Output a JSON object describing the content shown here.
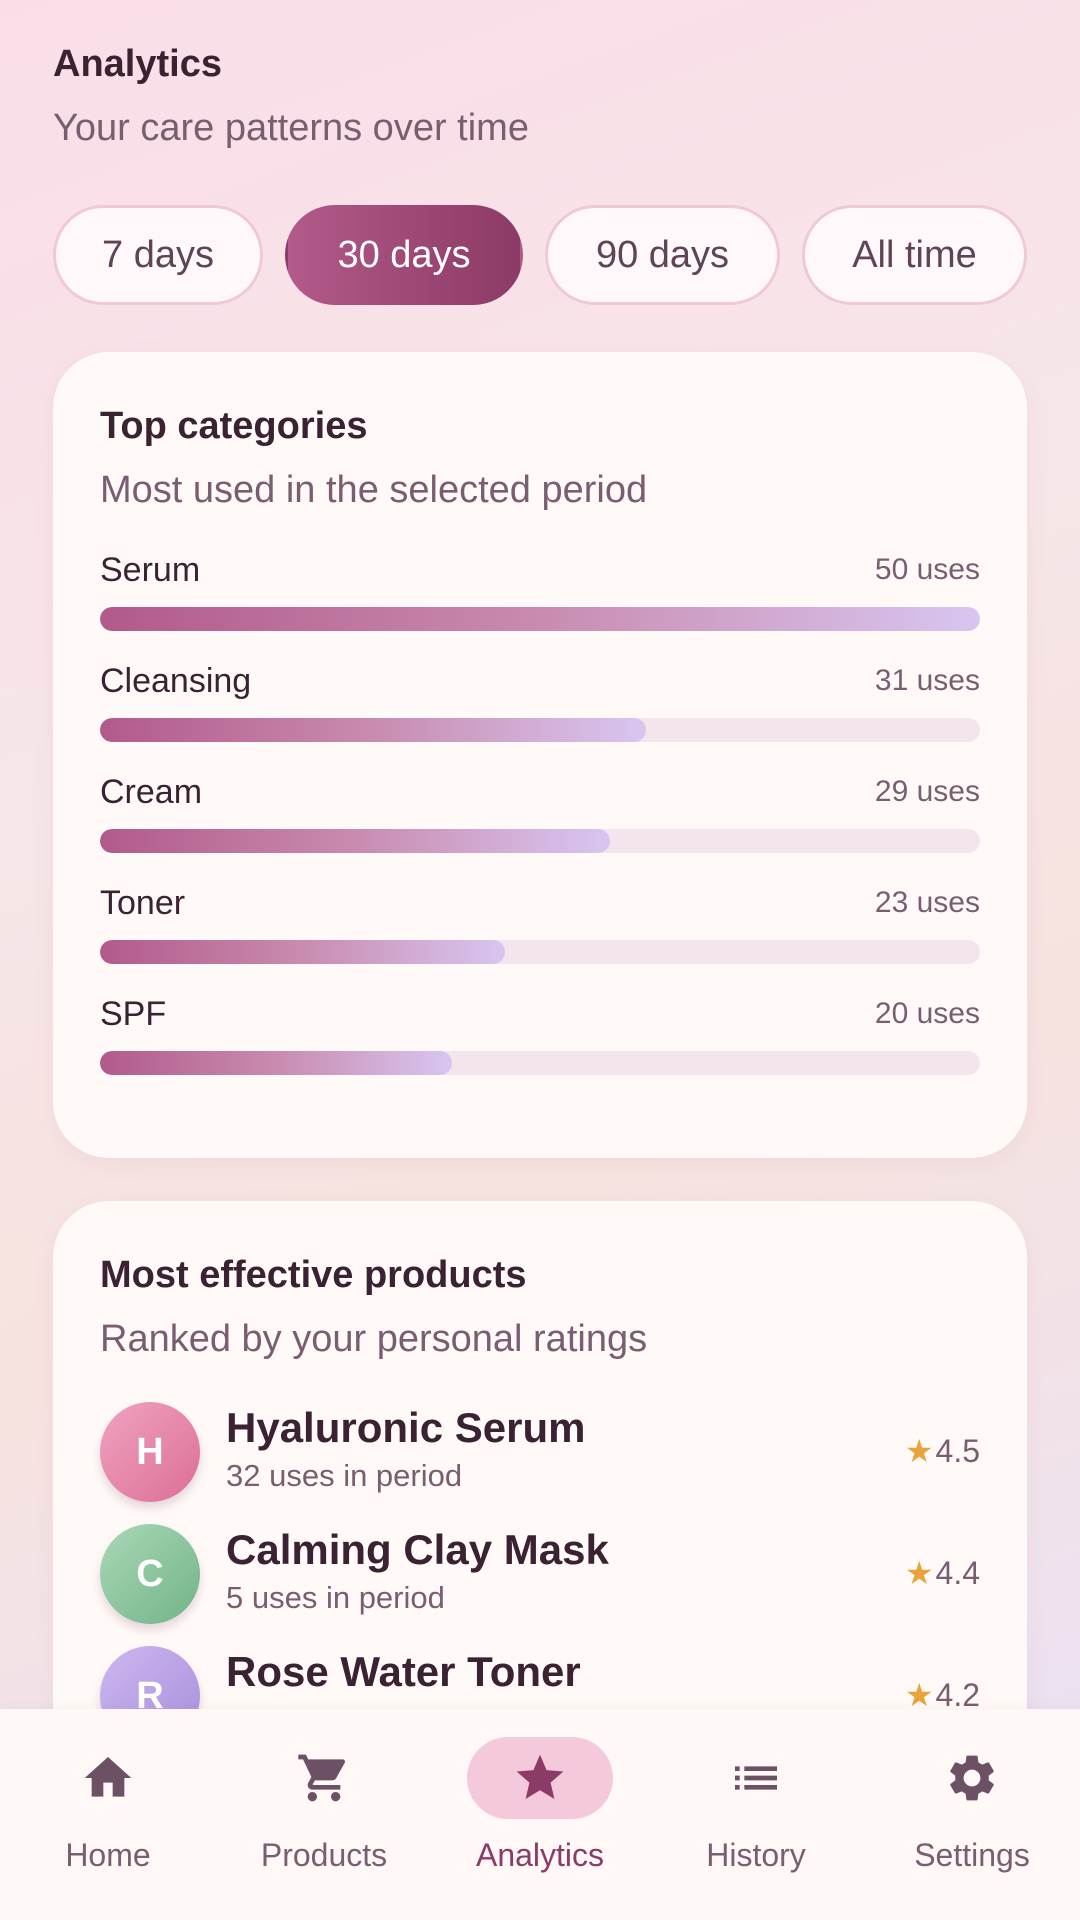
{
  "header": {
    "title": "Analytics",
    "subtitle": "Your care patterns over time"
  },
  "periods": [
    {
      "label": "7 days",
      "active": false
    },
    {
      "label": "30 days",
      "active": true
    },
    {
      "label": "90 days",
      "active": false
    },
    {
      "label": "All time",
      "active": false
    }
  ],
  "top_categories": {
    "title": "Top categories",
    "subtitle": "Most used in the selected period",
    "max": 50,
    "items": [
      {
        "name": "Serum",
        "uses": 50,
        "uses_label": "50 uses"
      },
      {
        "name": "Cleansing",
        "uses": 31,
        "uses_label": "31 uses"
      },
      {
        "name": "Cream",
        "uses": 29,
        "uses_label": "29 uses"
      },
      {
        "name": "Toner",
        "uses": 23,
        "uses_label": "23 uses"
      },
      {
        "name": "SPF",
        "uses": 20,
        "uses_label": "20 uses"
      }
    ]
  },
  "effective_products": {
    "title": "Most effective products",
    "subtitle": "Ranked by your personal ratings",
    "items": [
      {
        "initial": "H",
        "name": "Hyaluronic Serum",
        "uses_label": "32 uses in period",
        "rating": "4.5",
        "color_from": "#f0a3c0",
        "color_to": "#dc6e98"
      },
      {
        "initial": "C",
        "name": "Calming Clay Mask",
        "uses_label": "5 uses in period",
        "rating": "4.4",
        "color_from": "#a9d8b6",
        "color_to": "#72b389"
      },
      {
        "initial": "R",
        "name": "Rose Water Toner",
        "uses_label": "",
        "rating": "4.2",
        "color_from": "#cdb7ef",
        "color_to": "#a88fdc"
      }
    ]
  },
  "nav": [
    {
      "id": "home",
      "label": "Home",
      "icon": "home-icon",
      "active": false
    },
    {
      "id": "products",
      "label": "Products",
      "icon": "cart-icon",
      "active": false
    },
    {
      "id": "analytics",
      "label": "Analytics",
      "icon": "star-icon",
      "active": true
    },
    {
      "id": "history",
      "label": "History",
      "icon": "list-icon",
      "active": false
    },
    {
      "id": "settings",
      "label": "Settings",
      "icon": "gear-icon",
      "active": false
    }
  ],
  "colors": {
    "accent": "#8c3a66",
    "accent_light": "#b25a8a",
    "star": "#e8a33a"
  }
}
